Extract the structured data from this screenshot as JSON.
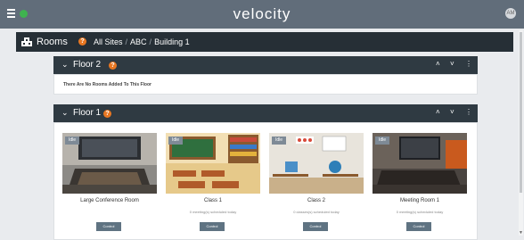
{
  "app": {
    "logo": "velocity",
    "avatar": "AM"
  },
  "breadcrumb": {
    "title": "Rooms",
    "items": [
      "All Sites",
      "ABC",
      "Building 1"
    ]
  },
  "floors": [
    {
      "title": "Floor 2",
      "empty_message": "There Are No Rooms Added To This Floor"
    },
    {
      "title": "Floor 1"
    }
  ],
  "rooms": [
    {
      "badge": "Idle",
      "name": "Large Conference Room",
      "schedule": "",
      "button": "Control"
    },
    {
      "badge": "Idle",
      "name": "Class 1",
      "schedule": "0 meeting(s) scheduled today",
      "button": "Control"
    },
    {
      "badge": "Idle",
      "name": "Class 2",
      "schedule": "0 classes(s) scheduled today",
      "button": "Control"
    },
    {
      "badge": "Idle",
      "name": "Meeting Room 1",
      "schedule": "0 meeting(s) scheduled today",
      "button": "Control"
    }
  ],
  "colors": {
    "accent": "#e87722",
    "status_dot": "#3fb34f",
    "header_bg": "#616d7a",
    "panel_bg": "#2f3a42"
  },
  "icons": {
    "menu": "hamburger-icon",
    "home": "building-icon",
    "help": "question-icon",
    "collapse": "chevron-down-icon",
    "expand": "chevron-up-icon",
    "more": "vertical-dots-icon"
  }
}
